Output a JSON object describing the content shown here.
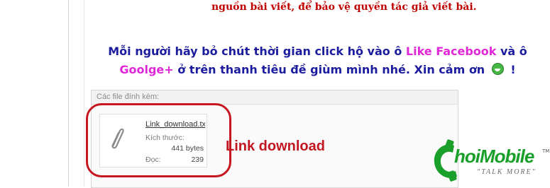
{
  "notice": {
    "text": "nguồn bài viết, để bảo vệ quyền tác giả viết bài."
  },
  "message": {
    "part1": "Mỗi người hãy bỏ chút thời gian click hộ vào ô ",
    "like_facebook": "Like Facebook",
    "part2": " và ô",
    "google_plus": "Goolge+",
    "part3": " ở trên thanh tiêu đề giùm mình nhé. Xin cảm ơn ",
    "smiley_icon": "grin-smiley-icon",
    "part4": " !"
  },
  "attachments": {
    "header": "Các file đính kèm:",
    "files": [
      {
        "name": "Link_download.txt",
        "size_label": "Kích thước:",
        "size_value": "441 bytes",
        "views_label": "Đọc:",
        "views_value": "239",
        "icon": "paperclip-icon"
      }
    ]
  },
  "annotation": {
    "label": "Link download",
    "color": "#c21721"
  },
  "watermark": {
    "main": "hoiMobile",
    "tm": "TM",
    "tagline": "\"TALK MORE\"",
    "icon": "phone-c-icon"
  },
  "colors": {
    "notice_red": "#c00000",
    "message_blue": "#1c1c9e",
    "accent_pink": "#e027d8",
    "logo_green": "#1a9f2b"
  }
}
